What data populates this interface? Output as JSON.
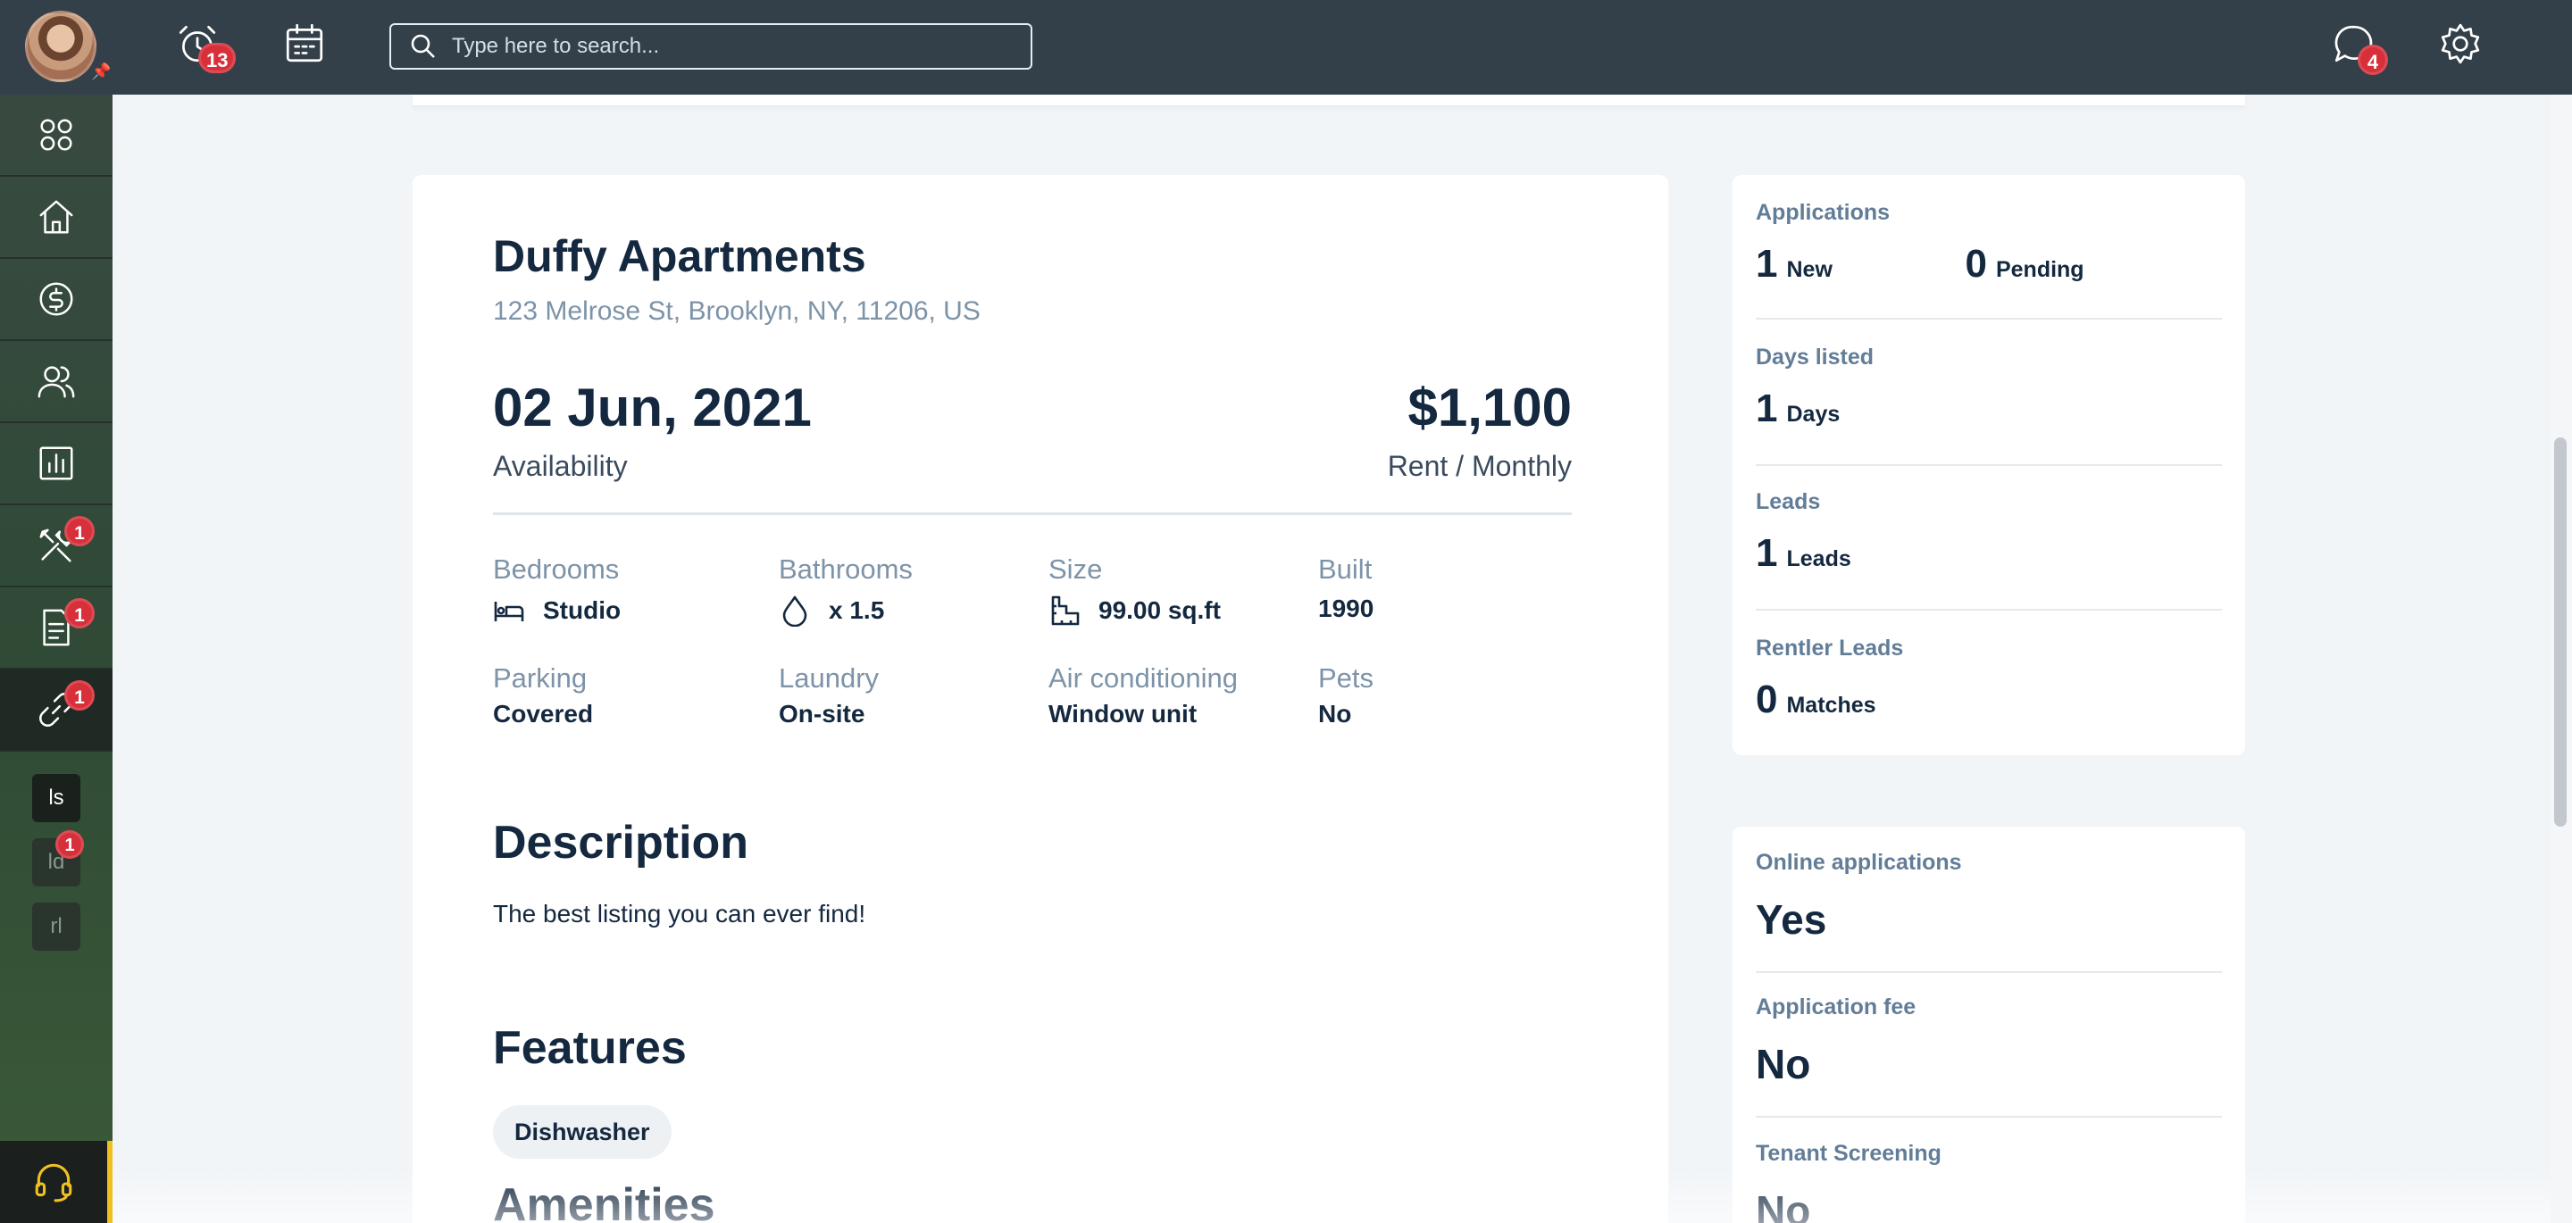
{
  "topbar": {
    "alerts_badge": "13",
    "search_placeholder": "Type here to search...",
    "messages_badge": "4"
  },
  "sidebar": {
    "badges": {
      "maintenance": "1",
      "documents": "1",
      "links": "1",
      "mini_ld": "1"
    },
    "mini": [
      "ls",
      "ld",
      "rl"
    ]
  },
  "listing": {
    "title": "Duffy Apartments",
    "address": "123 Melrose St, Brooklyn, NY, 11206, US",
    "availability_date": "02 Jun, 2021",
    "availability_label": "Availability",
    "rent": "$1,100",
    "rent_label": "Rent / Monthly",
    "specs": {
      "bedrooms": {
        "label": "Bedrooms",
        "value": "Studio"
      },
      "bathrooms": {
        "label": "Bathrooms",
        "value": "x 1.5"
      },
      "size": {
        "label": "Size",
        "value": "99.00 sq.ft"
      },
      "built": {
        "label": "Built",
        "value": "1990"
      },
      "parking": {
        "label": "Parking",
        "value": "Covered"
      },
      "laundry": {
        "label": "Laundry",
        "value": "On-site"
      },
      "air": {
        "label": "Air conditioning",
        "value": "Window unit"
      },
      "pets": {
        "label": "Pets",
        "value": "No"
      }
    },
    "description_title": "Description",
    "description_text": "The best listing you can ever find!",
    "features_title": "Features",
    "features": [
      "Dishwasher"
    ],
    "amenities_title": "Amenities"
  },
  "stats": {
    "applications_label": "Applications",
    "new_count": "1",
    "new_label": "New",
    "pending_count": "0",
    "pending_label": "Pending",
    "days_label": "Days listed",
    "days_count": "1",
    "days_unit": "Days",
    "leads_label": "Leads",
    "leads_count": "1",
    "leads_unit": "Leads",
    "rentler_label": "Rentler Leads",
    "rentler_count": "0",
    "rentler_unit": "Matches"
  },
  "settings": {
    "online_label": "Online applications",
    "online_value": "Yes",
    "fee_label": "Application fee",
    "fee_value": "No",
    "screening_label": "Tenant Screening",
    "screening_value": "No"
  },
  "colors": {
    "accent_badge": "#d8303a",
    "topbar": "#344049",
    "support": "#f0c020"
  }
}
